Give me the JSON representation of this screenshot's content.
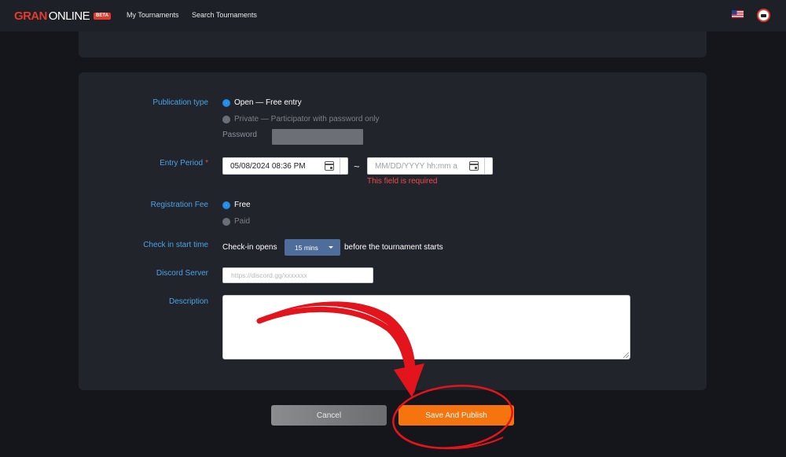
{
  "header": {
    "logo_primary": "GRAN",
    "logo_secondary": "ONLINE",
    "logo_badge": "BETA",
    "nav": [
      {
        "label": "My Tournaments"
      },
      {
        "label": "Search Tournaments"
      }
    ],
    "language_icon": "us-flag-icon",
    "avatar_icon": "user-avatar-icon"
  },
  "form": {
    "publication_type": {
      "label": "Publication type",
      "options": [
        {
          "label": "Open — Free entry",
          "selected": true
        },
        {
          "label": "Private — Participator with password only",
          "selected": false
        }
      ],
      "password_label": "Password",
      "password_value": ""
    },
    "entry_period": {
      "label": "Entry Period",
      "required_mark": "*",
      "start_value": "05/08/2024 08:36 PM",
      "separator": "~",
      "end_placeholder": "MM/DD/YYYY hh:mm a",
      "error": "This field is required"
    },
    "registration_fee": {
      "label": "Registration Fee",
      "options": [
        {
          "label": "Free",
          "selected": true
        },
        {
          "label": "Paid",
          "selected": false
        }
      ]
    },
    "check_in": {
      "label": "Check in start time",
      "prefix": "Check-in opens",
      "selected": "15 mins",
      "suffix": "before the tournament starts"
    },
    "discord": {
      "label": "Discord Server",
      "placeholder": "https://discord.gg/xxxxxxx",
      "value": ""
    },
    "description": {
      "label": "Description",
      "value": ""
    }
  },
  "actions": {
    "cancel_label": "Cancel",
    "publish_label": "Save And Publish"
  },
  "colors": {
    "brand_red": "#e23b2e",
    "label_blue": "#4aa3e8",
    "publish_orange": "#f5740d",
    "annotation_red": "#e3141b"
  }
}
